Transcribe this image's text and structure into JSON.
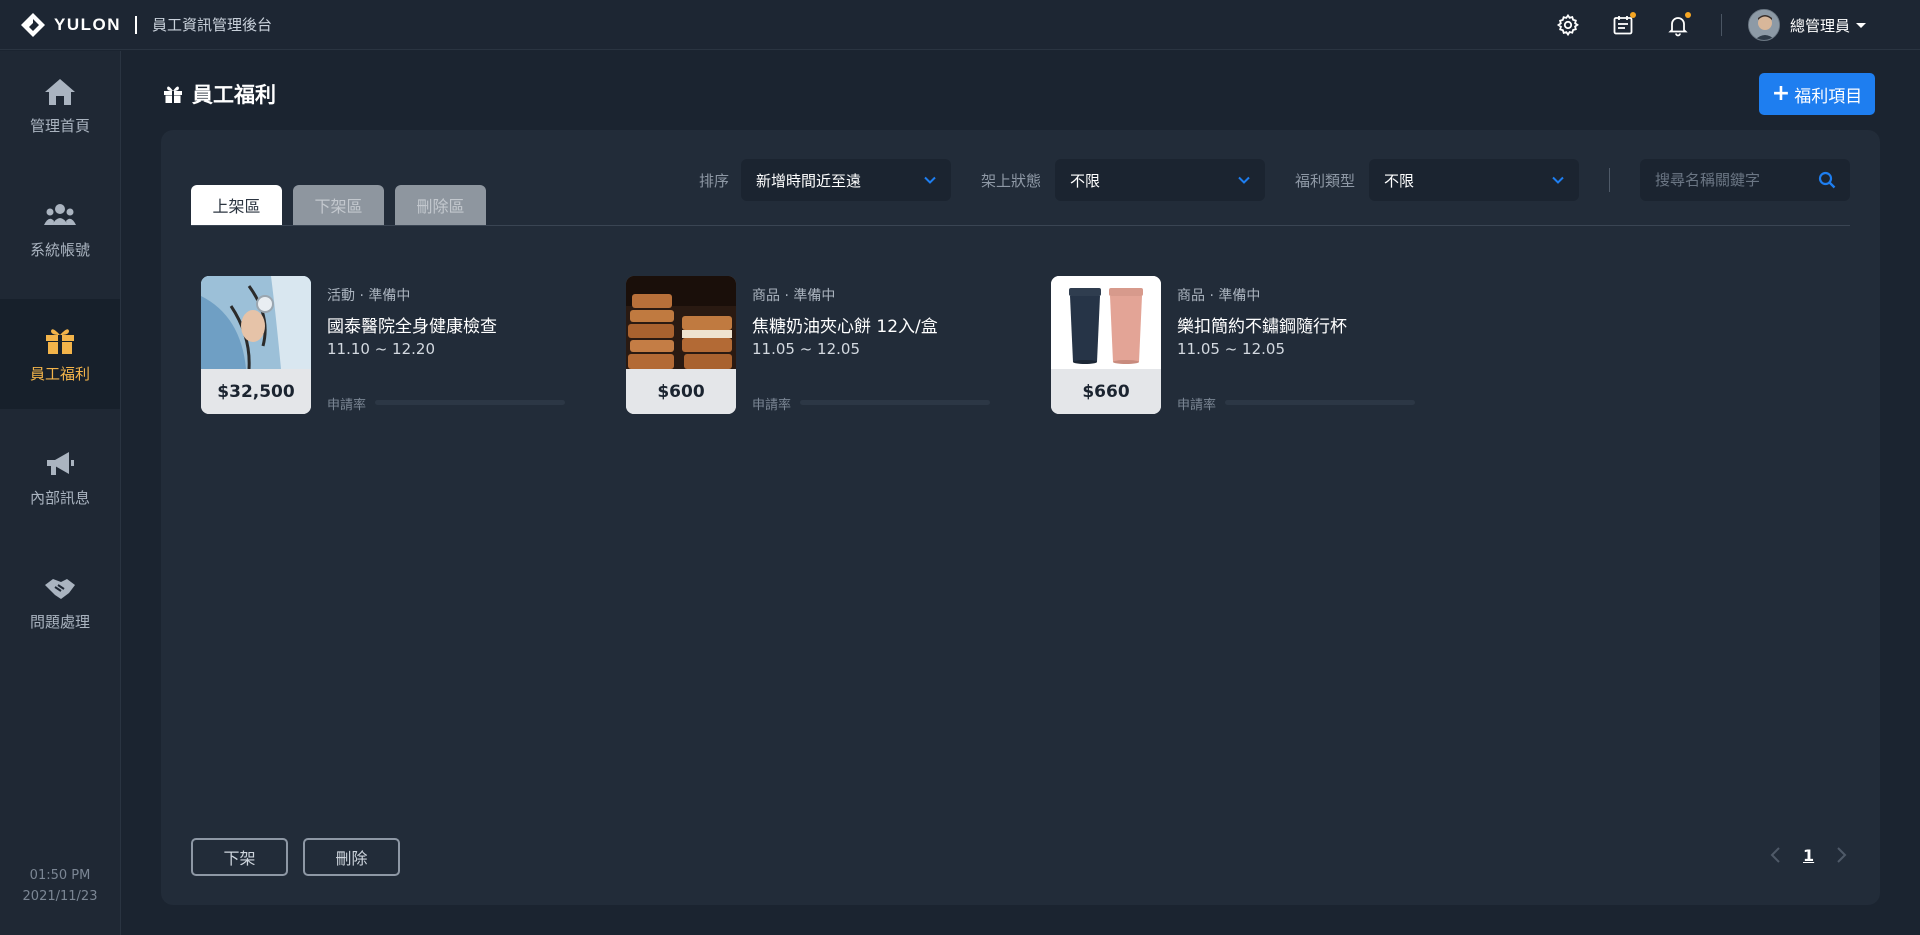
{
  "brand": {
    "name": "YULON",
    "app_title": "員工資訊管理後台"
  },
  "header": {
    "icons": [
      "gear-icon",
      "calendar-icon",
      "bell-icon"
    ],
    "user_name": "總管理員"
  },
  "sidebar": {
    "items": [
      {
        "label": "管理首頁",
        "icon": "home-icon"
      },
      {
        "label": "系統帳號",
        "icon": "users-icon"
      },
      {
        "label": "員工福利",
        "icon": "gift-icon",
        "active": true
      },
      {
        "label": "內部訊息",
        "icon": "megaphone-icon"
      },
      {
        "label": "問題處理",
        "icon": "handshake-icon"
      }
    ],
    "time": "01:50 PM",
    "date": "2021/11/23"
  },
  "page": {
    "title": "員工福利",
    "add_button": "福利項目"
  },
  "tabs": [
    {
      "label": "上架區",
      "active": true
    },
    {
      "label": "下架區"
    },
    {
      "label": "刪除區"
    }
  ],
  "filters": {
    "sort_label": "排序",
    "sort_value": "新增時間近至遠",
    "status_label": "架上狀態",
    "status_value": "不限",
    "type_label": "福利類型",
    "type_value": "不限",
    "search_placeholder": "搜尋名稱關鍵字"
  },
  "items": [
    {
      "meta": "活動 · 準備中",
      "name": "國泰醫院全身健康檢查",
      "date": "11.10 ~ 12.20",
      "price": "$32,500",
      "rate_label": "申請率",
      "rate": 0
    },
    {
      "meta": "商品 · 準備中",
      "name": "焦糖奶油夾心餅 12入/盒",
      "date": "11.05 ~ 12.05",
      "price": "$600",
      "rate_label": "申請率",
      "rate": 0
    },
    {
      "meta": "商品 · 準備中",
      "name": "樂扣簡約不鏽鋼隨行杯",
      "date": "11.05 ~ 12.05",
      "price": "$660",
      "rate_label": "申請率",
      "rate": 0
    }
  ],
  "actions": {
    "offshelf": "下架",
    "delete": "刪除"
  },
  "pagination": {
    "current": "1"
  },
  "colors": {
    "accent": "#1e7ef0",
    "active_nav": "#f3b44a",
    "notification_dot": "#f6a623"
  }
}
